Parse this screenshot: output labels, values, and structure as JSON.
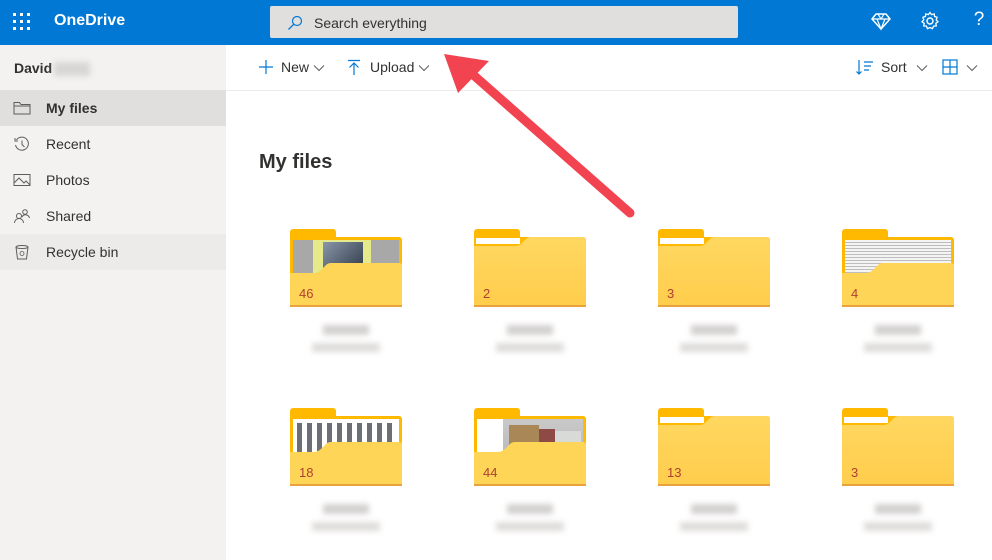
{
  "header": {
    "app_name": "OneDrive",
    "search_placeholder": "Search everything",
    "icons": [
      "app-launcher-icon",
      "premium-diamond-icon",
      "settings-gear-icon",
      "help-icon"
    ],
    "help_glyph": "?",
    "brand_color": "#0078d4"
  },
  "sidebar": {
    "user_first_name": "David",
    "items": [
      {
        "label": "My files",
        "icon": "folder-icon",
        "active": true
      },
      {
        "label": "Recent",
        "icon": "history-icon"
      },
      {
        "label": "Photos",
        "icon": "photo-icon"
      },
      {
        "label": "Shared",
        "icon": "people-icon"
      },
      {
        "label": "Recycle bin",
        "icon": "recycle-bin-icon"
      }
    ]
  },
  "toolbar": {
    "new_label": "New",
    "upload_label": "Upload",
    "sort_label": "Sort"
  },
  "main": {
    "title": "My files",
    "folders": [
      {
        "count": "46",
        "thumbnail": "photo"
      },
      {
        "count": "2",
        "thumbnail": "none"
      },
      {
        "count": "3",
        "thumbnail": "none"
      },
      {
        "count": "4",
        "thumbnail": "document"
      },
      {
        "count": "18",
        "thumbnail": "image-grid"
      },
      {
        "count": "44",
        "thumbnail": "building-photo"
      },
      {
        "count": "13",
        "thumbnail": "none"
      },
      {
        "count": "3",
        "thumbnail": "none"
      }
    ]
  },
  "annotation": {
    "type": "arrow",
    "color": "#f04048",
    "points_to": "search-box"
  }
}
